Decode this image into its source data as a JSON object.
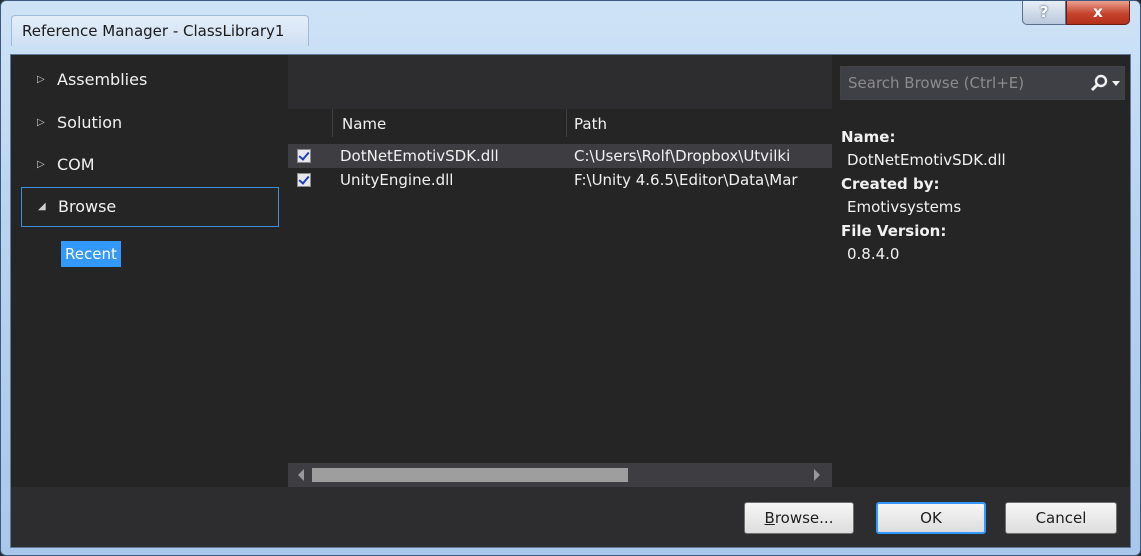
{
  "window": {
    "title": "Reference Manager - ClassLibrary1",
    "help_glyph": "?",
    "close_glyph": "x"
  },
  "nav": {
    "items": [
      {
        "label": "Assemblies",
        "arrow": "▷"
      },
      {
        "label": "Solution",
        "arrow": "▷"
      },
      {
        "label": "COM",
        "arrow": "▷"
      },
      {
        "label": "Browse",
        "arrow": "◢"
      }
    ],
    "sub_items": [
      {
        "label": "Recent"
      }
    ]
  },
  "search": {
    "placeholder": "Search Browse (Ctrl+E)"
  },
  "list": {
    "columns": {
      "name": "Name",
      "path": "Path"
    },
    "rows": [
      {
        "checked": true,
        "name": "DotNetEmotivSDK.dll",
        "path": "C:\\Users\\Rolf\\Dropbox\\Utvilki"
      },
      {
        "checked": true,
        "name": "UnityEngine.dll",
        "path": "F:\\Unity 4.6.5\\Editor\\Data\\Mar"
      }
    ]
  },
  "details": {
    "name_label": "Name:",
    "name_value": "DotNetEmotivSDK.dll",
    "created_label": "Created by:",
    "created_value": "Emotivsystems",
    "version_label": "File Version:",
    "version_value": "0.8.4.0"
  },
  "footer": {
    "browse_label": "rowse...",
    "browse_mnemonic": "B",
    "ok_label": "OK",
    "cancel_label": "Cancel"
  },
  "colors": {
    "accent": "#3399ff",
    "background": "#252526",
    "text": "#f1f1f1"
  }
}
